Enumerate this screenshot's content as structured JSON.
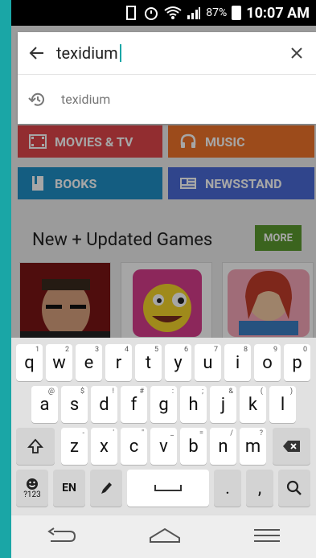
{
  "status": {
    "battery_percent": "87%",
    "time": "10:07 AM"
  },
  "search": {
    "query": "texidium",
    "suggestion": "texidium"
  },
  "categories": {
    "movies": "MOVIES & TV",
    "music": "MUSIC",
    "books": "BOOKS",
    "newsstand": "NEWSSTAND"
  },
  "section": {
    "title": "New + Updated Games",
    "more": "MORE"
  },
  "keyboard": {
    "row1": [
      "q",
      "w",
      "e",
      "r",
      "t",
      "y",
      "u",
      "i",
      "o",
      "p"
    ],
    "row1_sub": [
      "1",
      "2",
      "3",
      "4",
      "5",
      "6",
      "7",
      "8",
      "9",
      "0"
    ],
    "row2": [
      "a",
      "s",
      "d",
      "f",
      "g",
      "h",
      "j",
      "k",
      "l"
    ],
    "row2_sub": [
      "@",
      "$",
      "!",
      "#",
      ":",
      ";",
      "&",
      "(",
      ")"
    ],
    "row3": [
      "z",
      "x",
      "c",
      "v",
      "b",
      "n",
      "m"
    ],
    "row3_sub": [
      "-",
      "'",
      "\"",
      "_",
      "=",
      "/",
      "?"
    ],
    "emoji_label": "?123",
    "lang_label": "EN"
  },
  "colors": {
    "movies": "#e0464b",
    "music": "#f0742a",
    "books": "#1f8fc7",
    "newsstand": "#4a6bd8",
    "more": "#5b9a2e",
    "accent": "#1aa6a6"
  }
}
